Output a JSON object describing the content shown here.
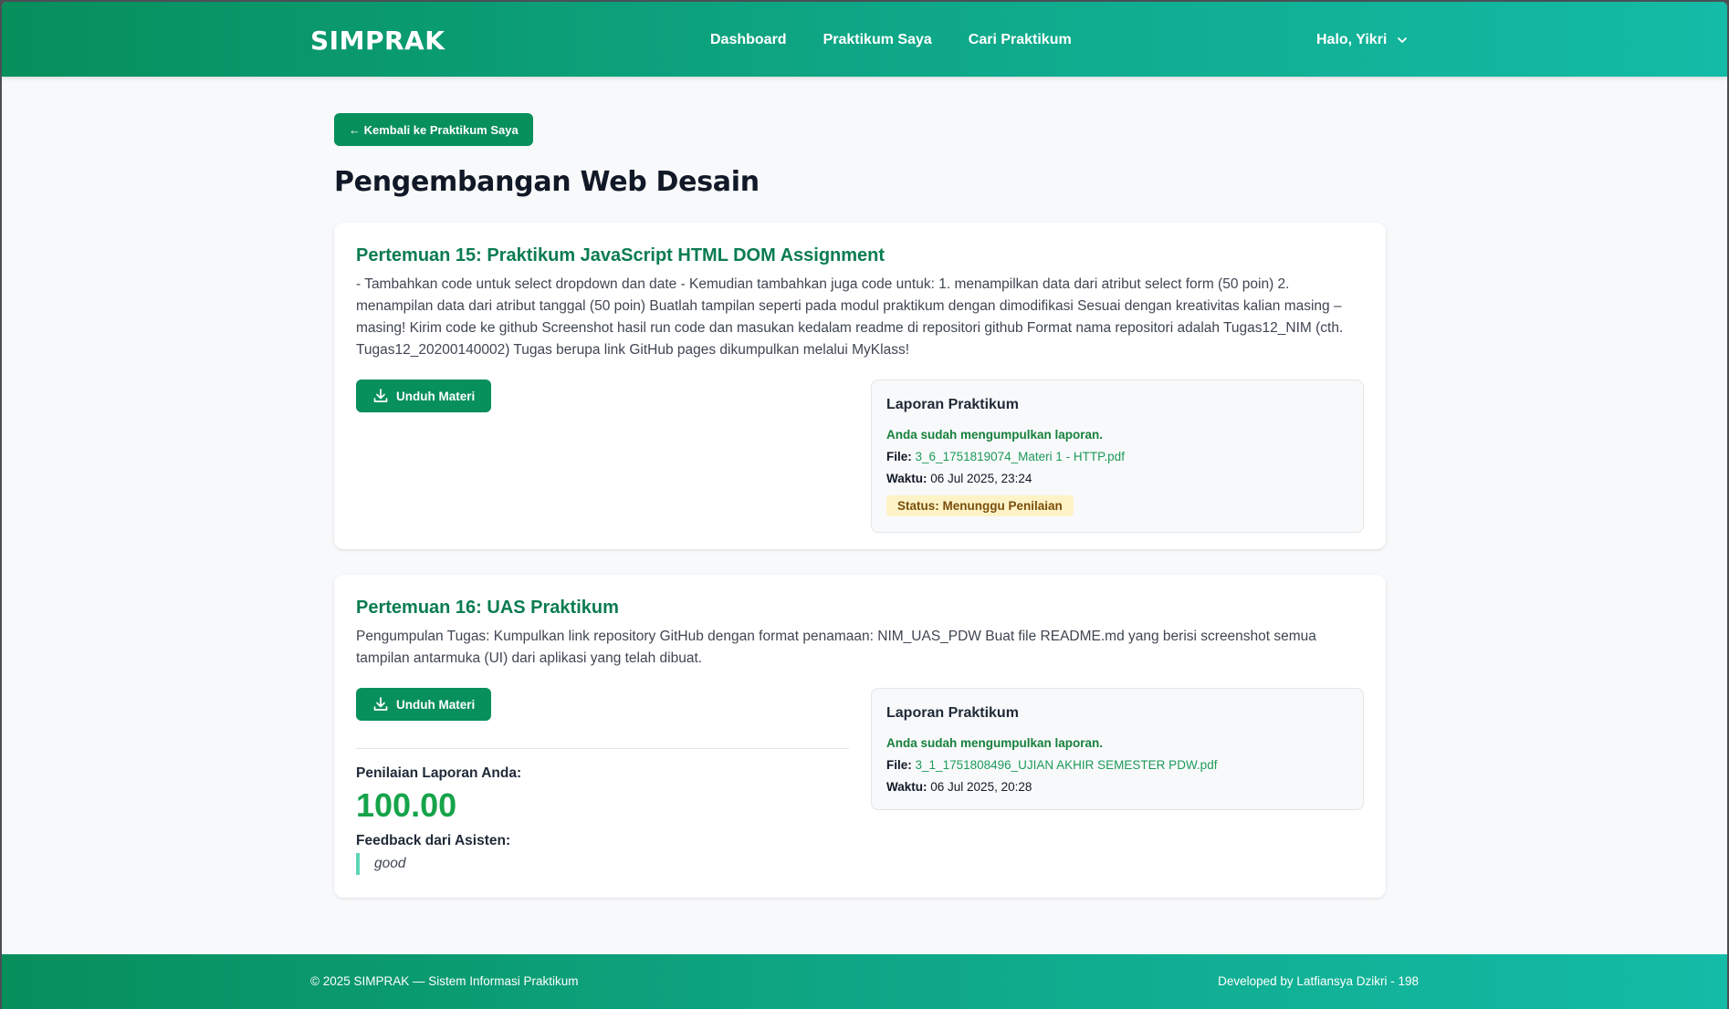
{
  "navbar": {
    "brand": "SIMPRAK",
    "links": [
      "Dashboard",
      "Praktikum Saya",
      "Cari Praktikum"
    ],
    "user_greeting": "Halo, Yikri"
  },
  "main": {
    "back_label": "← Kembali ke Praktikum Saya",
    "title": "Pengembangan Web Desain",
    "cards": [
      {
        "title": "Pertemuan 15: Praktikum JavaScript HTML DOM Assignment",
        "description": "- Tambahkan code untuk select dropdown dan date - Kemudian tambahkan juga code untuk: 1. menampilkan data dari atribut select form (50 poin) 2. menampilan data dari atribut tanggal (50 poin) Buatlah tampilan seperti pada modul praktikum dengan dimodifikasi Sesuai dengan kreativitas kalian masing – masing! Kirim code ke github Screenshot hasil run code dan masukan kedalam readme di repositori github Format nama repositori adalah Tugas12_NIM (cth. Tugas12_20200140002) Tugas berupa link GitHub pages dikumpulkan melalui MyKlass!",
        "download_label": "Unduh Materi",
        "report": {
          "title": "Laporan Praktikum",
          "submitted_text": "Anda sudah mengumpulkan laporan.",
          "file_label": "File:",
          "file_name": "3_6_1751819074_Materi 1 - HTTP.pdf",
          "time_label": "Waktu:",
          "time_value": "06 Jul 2025, 23:24",
          "status": "Status: Menunggu Penilaian"
        }
      },
      {
        "title": "Pertemuan 16: UAS Praktikum",
        "description": "Pengumpulan Tugas: Kumpulkan link repository GitHub dengan format penamaan: NIM_UAS_PDW Buat file README.md yang berisi screenshot semua tampilan antarmuka (UI) dari aplikasi yang telah dibuat.",
        "download_label": "Unduh Materi",
        "report": {
          "title": "Laporan Praktikum",
          "submitted_text": "Anda sudah mengumpulkan laporan.",
          "file_label": "File:",
          "file_name": "3_1_1751808496_UJIAN AKHIR SEMESTER PDW.pdf",
          "time_label": "Waktu:",
          "time_value": "06 Jul 2025, 20:28"
        },
        "grade": {
          "label": "Penilaian Laporan Anda:",
          "value": "100.00",
          "feedback_label": "Feedback dari Asisten:",
          "feedback": "good"
        }
      }
    ]
  },
  "footer": {
    "left": "© 2025 SIMPRAK — Sistem Informasi Praktikum",
    "right": "Developed by Latfiansya Dzikri - 198"
  },
  "colors": {
    "primary": "#078f5c",
    "accent": "#14bba6",
    "grade": "#16a34a",
    "status_bg": "#fdf3c7"
  }
}
